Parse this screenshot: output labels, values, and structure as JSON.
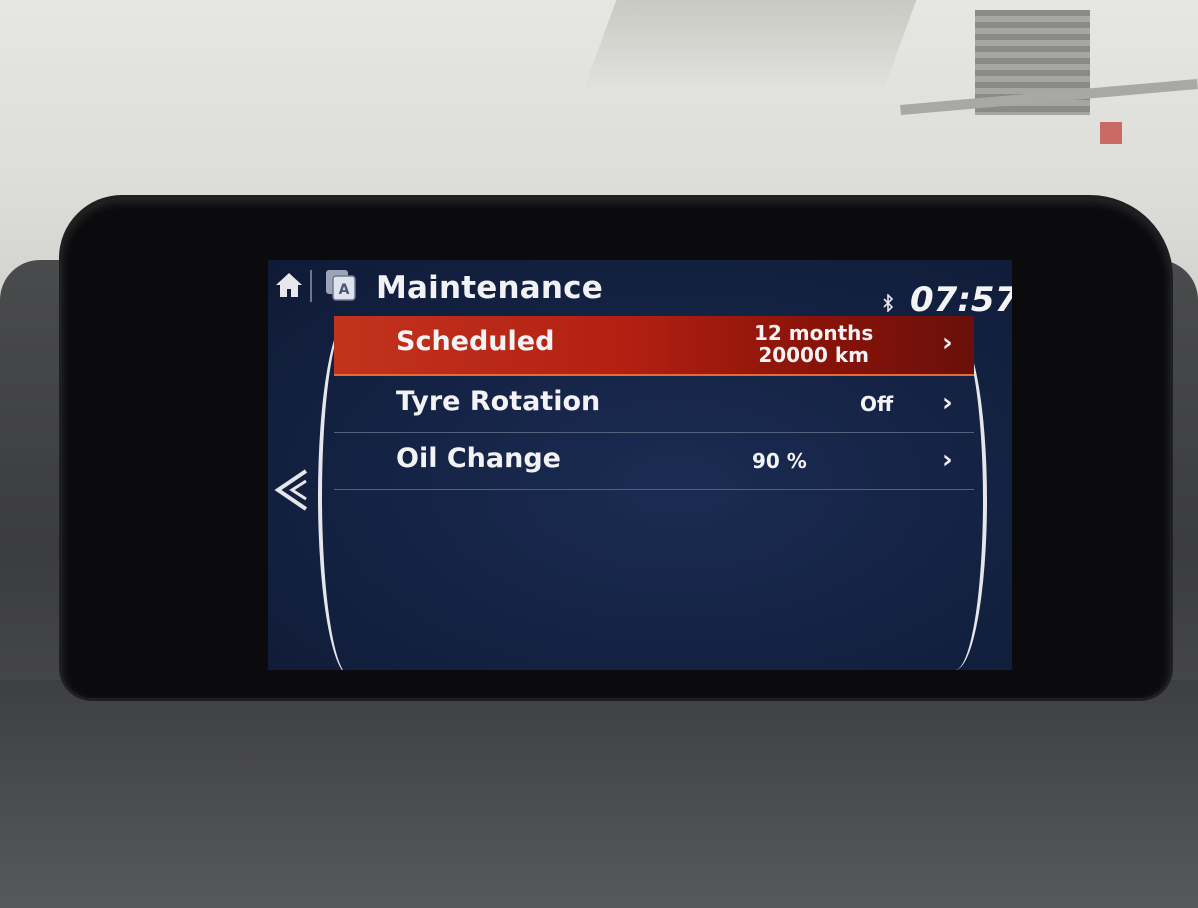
{
  "header": {
    "title": "Maintenance",
    "time": "07:57"
  },
  "icons": {
    "home": "home-icon",
    "app": "app-icon",
    "bluetooth": "bluetooth-icon",
    "back": "back-chevron-icon"
  },
  "menu": {
    "items": [
      {
        "label": "Scheduled",
        "value_line1": "12 months",
        "value_line2": "20000 km",
        "active": true
      },
      {
        "label": "Tyre Rotation",
        "value": "Off",
        "active": false
      },
      {
        "label": "Oil Change",
        "value": "90 %",
        "active": false
      }
    ]
  },
  "colors": {
    "selection": "#b32012",
    "screen_bg": "#152446",
    "text": "#f3f3f5"
  }
}
